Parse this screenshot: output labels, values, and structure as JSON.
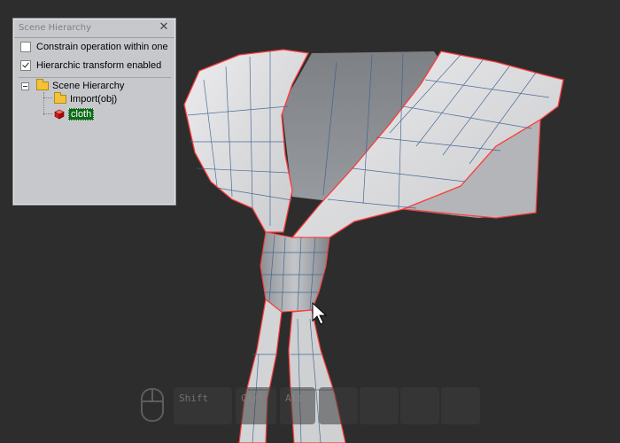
{
  "panel": {
    "title": "Scene Hierarchy",
    "close_glyph": "✕",
    "options": [
      {
        "label": "Constrain operation within one",
        "checked": false
      },
      {
        "label": "Hierarchic transform enabled",
        "checked": true
      }
    ],
    "tree": {
      "root": {
        "label": "Scene Hierarchy",
        "icon": "folder-icon",
        "expanded": true
      },
      "children": [
        {
          "label": "Import(obj)",
          "icon": "folder-icon",
          "selected": false
        },
        {
          "label": "cloth",
          "icon": "mesh-cube-icon",
          "selected": true
        }
      ]
    }
  },
  "keys": {
    "mouse_icon": "mouse-icon",
    "labels": [
      "Shift",
      "Ctrl",
      "Alt",
      "",
      "",
      "",
      ""
    ]
  },
  "colors": {
    "background": "#2d2d2d",
    "mesh_fill": "#d9dadc",
    "mesh_edge": "#3e5f8e",
    "outline": "#ff3b3b",
    "selection": "#0c6b17"
  }
}
